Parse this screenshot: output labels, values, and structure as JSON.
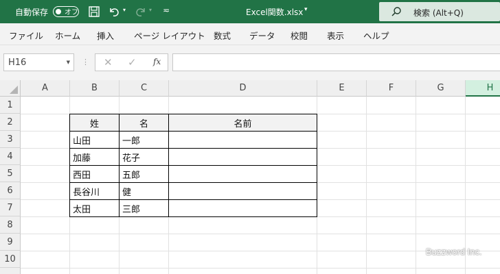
{
  "titlebar": {
    "autosave_label": "自動保存",
    "autosave_toggle": "オフ",
    "document_title": "Excel関数.xlsx",
    "search_placeholder": "検索 (Alt+Q)"
  },
  "menu": [
    "ファイル",
    "ホーム",
    "挿入",
    "ページ レイアウト",
    "数式",
    "データ",
    "校閲",
    "表示",
    "ヘルプ"
  ],
  "formula_bar": {
    "name_box": "H16",
    "formula": ""
  },
  "sheet": {
    "columns": [
      "A",
      "B",
      "C",
      "D",
      "E",
      "F",
      "G",
      "H"
    ],
    "selected_column": "H",
    "rows": [
      "1",
      "2",
      "3",
      "4",
      "5",
      "6",
      "7",
      "8",
      "9",
      "10"
    ],
    "table": {
      "headers": [
        "姓",
        "名",
        "名前"
      ],
      "rows": [
        [
          "山田",
          "一郎",
          ""
        ],
        [
          "加藤",
          "花子",
          ""
        ],
        [
          "西田",
          "五郎",
          ""
        ],
        [
          "長谷川",
          "健",
          ""
        ],
        [
          "太田",
          "三郎",
          ""
        ]
      ]
    }
  },
  "watermark": "Buzzword Inc.",
  "colors": {
    "accent": "#217346",
    "header_fill": "#f2f2f2"
  }
}
